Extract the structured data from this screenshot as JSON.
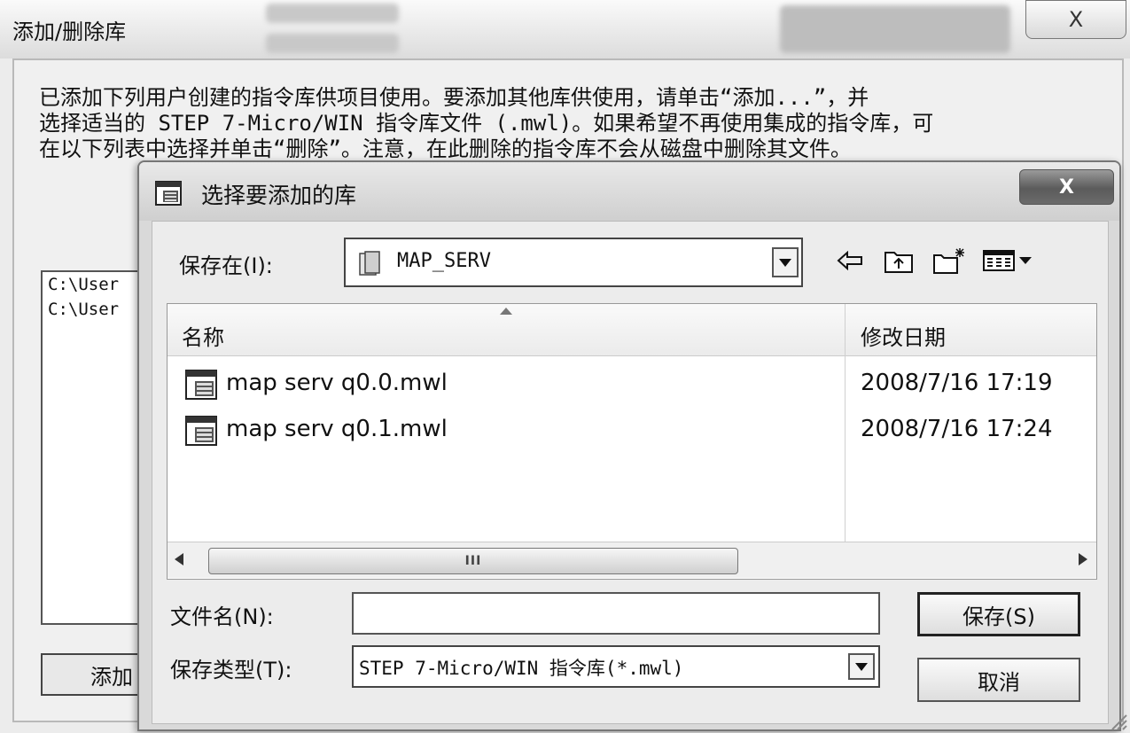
{
  "background_dialog": {
    "title": "添加/删除库",
    "close_glyph": "X",
    "description": "已添加下列用户创建的指令库供项目使用。要添加其他库供使用，请单击“添加...”，并\n选择适当的 STEP 7-Micro/WIN 指令库文件 (.mwl)。如果希望不再使用集成的指令库，可\n在以下列表中选择并单击“删除”。注意，在此删除的指令库不会从磁盘中删除其文件。",
    "list_items": [
      "C:\\User",
      "C:\\User"
    ],
    "add_button": "添加"
  },
  "dialog": {
    "title": "选择要添加的库",
    "close_glyph": "X",
    "save_in_label": "保存在(I):",
    "save_in_value": "MAP_SERV",
    "columns": {
      "name": "名称",
      "date": "修改日期"
    },
    "files": [
      {
        "name": "map serv q0.0.mwl",
        "date": "2008/7/16 17:19"
      },
      {
        "name": "map serv q0.1.mwl",
        "date": "2008/7/16 17:24"
      }
    ],
    "scroll_thumb_grip": "III",
    "filename_label": "文件名(N):",
    "filename_value": "",
    "filetype_label": "保存类型(T):",
    "filetype_value": "STEP 7-Micro/WIN 指令库(*.mwl)",
    "save_button": "保存(S)",
    "cancel_button": "取消"
  },
  "icons": [
    "back-arrow-icon",
    "up-folder-icon",
    "new-folder-icon",
    "view-menu-icon",
    "folder-icon",
    "library-file-icon",
    "sort-up-icon"
  ]
}
